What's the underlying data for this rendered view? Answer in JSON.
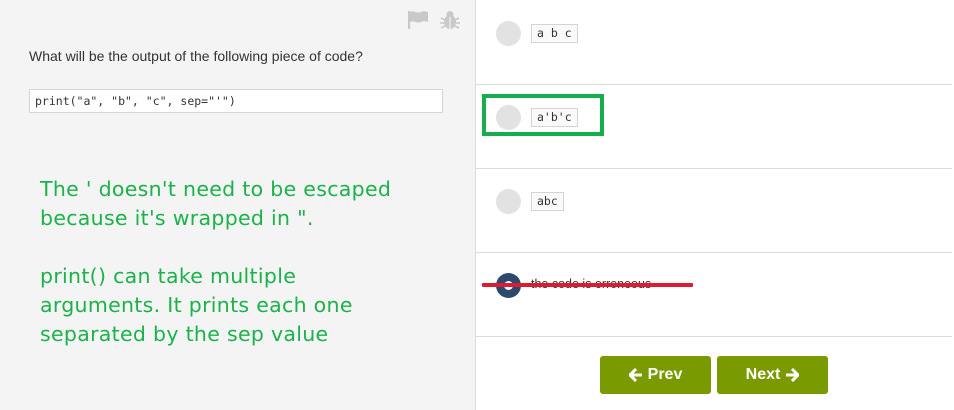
{
  "question": {
    "prompt": "What will be the output of the following piece of code?",
    "code": "print(\"a\", \"b\", \"c\", sep=\"'\")"
  },
  "annotation": {
    "line1": "The ' doesn't need to be escaped\nbecause it's wrapped in \".",
    "line2": "print() can take multiple\narguments. It prints each one\nseparated by the sep value"
  },
  "options": [
    {
      "label": "a b c",
      "selected": false
    },
    {
      "label": "a'b'c",
      "selected": false
    },
    {
      "label": "abc",
      "selected": false
    },
    {
      "label": "the code is erroneous",
      "selected": true
    }
  ],
  "toolbar": {
    "flag_icon": "flag-icon",
    "bug_icon": "bug-icon"
  },
  "nav": {
    "prev_label": "Prev",
    "next_label": "Next"
  },
  "colors": {
    "accent": "#7a9a01",
    "annotation": "#19b349",
    "highlight_box": "#16ad4d",
    "strike": "#dd1c34",
    "selected_radio": "#2b4a6e"
  }
}
